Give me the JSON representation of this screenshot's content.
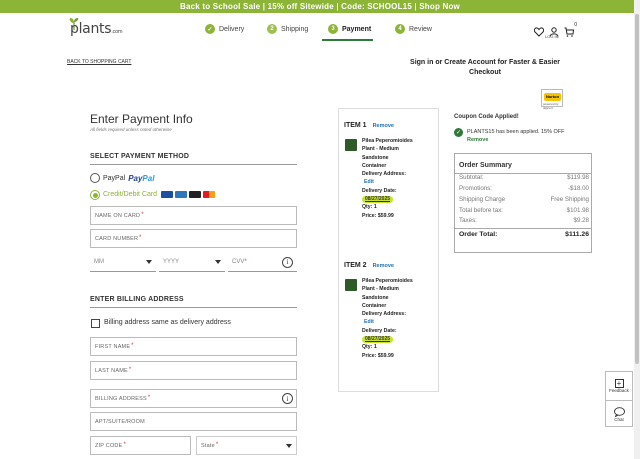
{
  "banner": {
    "text": "Back to School Sale | 15% off Sitewide | Code: SCHOOL15 | Shop Now"
  },
  "header": {
    "logo": "plants",
    "logo_suffix": ".com",
    "steps": [
      {
        "num": "1",
        "label": "Delivery",
        "state": "done"
      },
      {
        "num": "2",
        "label": "Shipping",
        "state": "done"
      },
      {
        "num": "3",
        "label": "Payment",
        "state": "active"
      },
      {
        "num": "4",
        "label": "Review",
        "state": "future"
      }
    ],
    "account_label": "LOG IN",
    "cart_count": "0"
  },
  "back_link": "BACK TO SHOPPING CART",
  "signin": "Sign in or Create Account for Faster & Easier Checkout",
  "norton": {
    "text": "Norton",
    "sub": "powered by digicert"
  },
  "payment": {
    "title": "Enter Payment Info",
    "note": "All fields required unless noted otherwise",
    "method_title": "SELECT PAYMENT METHOD",
    "paypal_label": "PayPal",
    "paypal_logo_a": "Pay",
    "paypal_logo_b": "Pal",
    "card_label": "Credit/Debit Card",
    "name_placeholder": "NAME ON CARD",
    "number_placeholder": "CARD NUMBER",
    "mm": "MM",
    "yyyy": "YYYY",
    "cvv": "CVV",
    "req": "*"
  },
  "billing": {
    "title": "ENTER BILLING ADDRESS",
    "same_label": "Billing address same as delivery address",
    "first": "FIRST NAME",
    "last": "LAST NAME",
    "address": "BILLING ADDRESS",
    "apt": "APT/SUITE/ROOM",
    "zip": "ZIP CODE",
    "state": "State"
  },
  "items": [
    {
      "head": "ITEM 1",
      "remove": "Remove",
      "name_lines": [
        "Pilea Peperomioides",
        "Plant - Medium",
        "Sandstone",
        "Container"
      ],
      "delivery_label": "Delivery Address:",
      "edit": "Edit",
      "date_label": "Delivery Date:",
      "date": "08/27/2025",
      "qty": "Qty: 1",
      "price": "Price: $59.99"
    },
    {
      "head": "ITEM 2",
      "remove": "Remove",
      "name_lines": [
        "Pilea Peperomioides",
        "Plant - Medium",
        "Sandstone",
        "Container"
      ],
      "delivery_label": "Delivery Address:",
      "edit": "Edit",
      "date_label": "Delivery Date:",
      "date": "08/27/2025",
      "qty": "Qty: 1",
      "price": "Price: $59.99"
    }
  ],
  "coupon": {
    "title": "Coupon Code Applied!",
    "line": "PLANTS15 has been applied. 15% OFF",
    "remove": "Remove"
  },
  "summary": {
    "title": "Order Summary",
    "rows": [
      {
        "label": "Subtotal:",
        "value": "$119.98"
      },
      {
        "label": "Promotions:",
        "value": "-$18.00"
      },
      {
        "label": "Shipping Charge",
        "value": "Free Shipping"
      },
      {
        "label": "Total before tax:",
        "value": "$101.98"
      },
      {
        "label": "Taxes:",
        "value": "$9.28"
      }
    ],
    "total_label": "Order Total:",
    "total_value": "$111.26"
  },
  "feedback": {
    "feedback": "Feedback",
    "chat": "Chat"
  },
  "colors": {
    "accent": "#8cb436",
    "link": "#1a6fb3",
    "dark_green": "#2d7a3a"
  }
}
